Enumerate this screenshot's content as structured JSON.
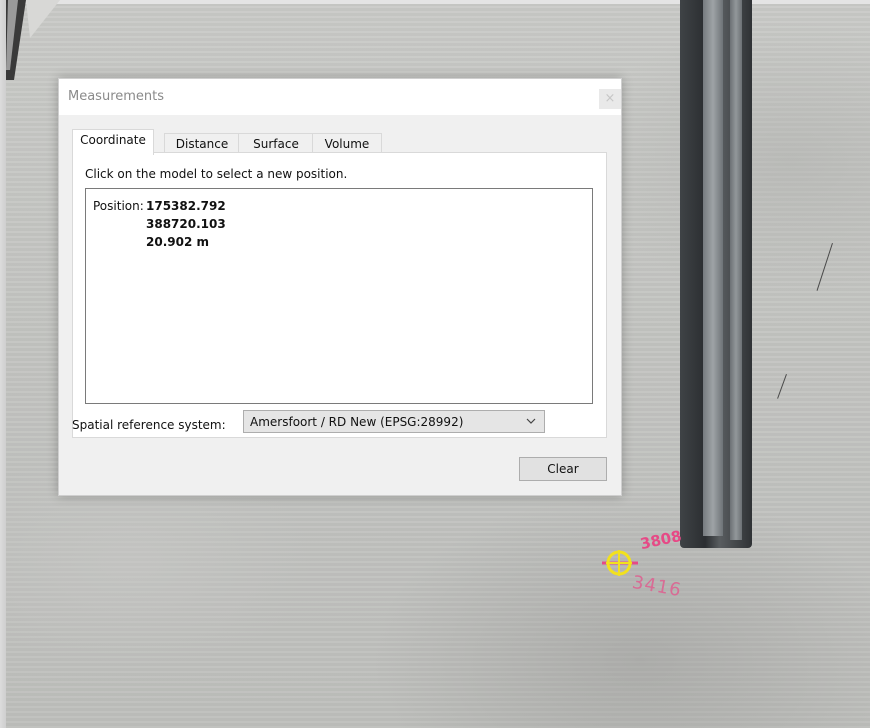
{
  "window": {
    "title": "Measurements",
    "close_label": "×"
  },
  "tabs": [
    {
      "label": "Coordinate",
      "active": true
    },
    {
      "label": "Distance",
      "active": false
    },
    {
      "label": "Surface",
      "active": false
    },
    {
      "label": "Volume",
      "active": false
    }
  ],
  "coordinate_panel": {
    "hint": "Click on the model to select a new position.",
    "position_label": "Position:",
    "x": "175382.792",
    "y": "388720.103",
    "z": "20.902 m"
  },
  "spatial_reference": {
    "label": "Spatial reference system:",
    "selected": "Amersfoort / RD New (EPSG:28992)"
  },
  "buttons": {
    "clear": "Clear"
  },
  "scene": {
    "paint_top": "3808",
    "paint_bottom": "3416",
    "colors": {
      "paint": "#e64a86",
      "crosshair": "#f2e11d",
      "seam": "#2b2e31"
    }
  }
}
